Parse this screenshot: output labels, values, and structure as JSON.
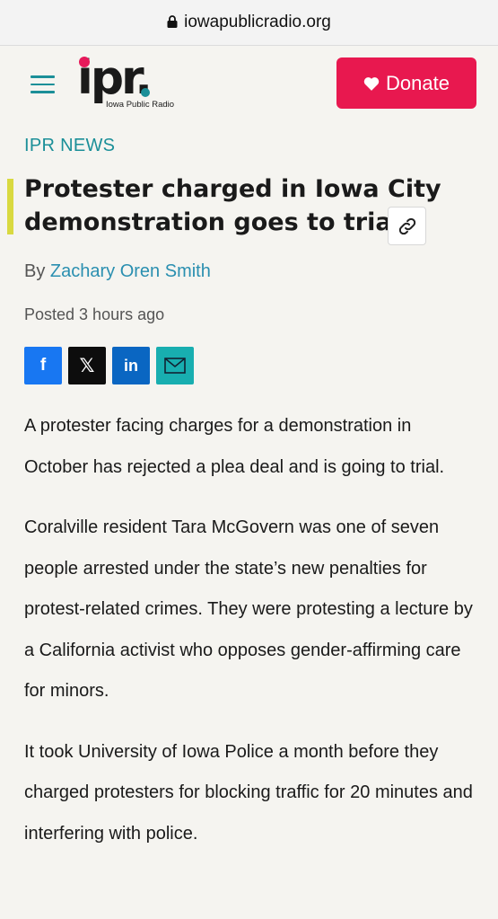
{
  "browser": {
    "url": "iowapublicradio.org",
    "lock_icon": "lock-icon"
  },
  "header": {
    "menu_icon": "hamburger-menu-icon",
    "logo_text": "ipr.",
    "logo_subtitle": "Iowa Public Radio",
    "donate_label": "Donate",
    "donate_icon": "heart-icon",
    "colors": {
      "brand_pink": "#e8184f",
      "brand_teal": "#1b8f98"
    }
  },
  "article": {
    "kicker": "IPR NEWS",
    "title": "Protester charged in Iowa City demonstration goes to trial",
    "copy_link_icon": "link-icon",
    "byline_prefix": "By",
    "author": "Zachary Oren Smith",
    "posted": "Posted 3 hours ago",
    "share": [
      {
        "name": "facebook",
        "glyph": "f",
        "color": "#1877f2"
      },
      {
        "name": "x",
        "glyph": "𝕏",
        "color": "#0d0d0d"
      },
      {
        "name": "linkedin",
        "glyph": "in",
        "color": "#0a66c2"
      },
      {
        "name": "email",
        "glyph": "",
        "color": "#18aeb0"
      }
    ],
    "paragraphs": [
      "A protester facing charges for a demonstration in October has rejected a plea deal and is going to trial.",
      "Coralville resident Tara McGovern was one of seven people arrested under the state’s new penalties for protest-related crimes. They were protesting a lecture by a California activist who opposes gender-affirming care for minors.",
      "It took University of Iowa Police a month before they charged protesters for blocking traffic for 20 minutes and interfering with police."
    ]
  }
}
